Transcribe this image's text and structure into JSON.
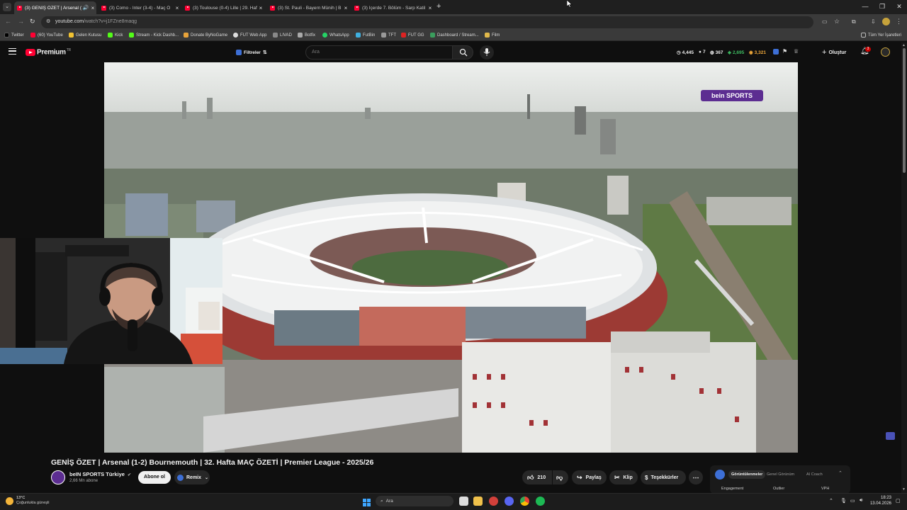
{
  "browser": {
    "tabs": [
      {
        "label": "(3) GENİŞ ÖZET | Arsenal (1",
        "active": true
      },
      {
        "label": "(3) Como - Inter (3-4) - Maç Ö",
        "active": false
      },
      {
        "label": "(3) Toulouse (0-4) Lille | 29. Haf",
        "active": false
      },
      {
        "label": "(3) St. Pauli - Bayern Münih | B",
        "active": false
      },
      {
        "label": "(3) İçerde 7. Bölüm - Sarp Katil",
        "active": false
      }
    ],
    "url_host": "youtube.com",
    "url_path": "/watch?v=j1FZne8maqg",
    "bookmarks": [
      "Twitter",
      "(60) YouTube",
      "Gelen Kutusu",
      "Kick",
      "Stream - Kick Dashb...",
      "Donate ByNoGame",
      "FUT Web App",
      "LIVAD",
      "Botfix",
      "WhatsApp",
      "FutBin",
      "TFT",
      "FUT GG",
      "Dashboard / Stream...",
      "Film"
    ],
    "bookmarks_all": "Tüm Yer İşaretleri"
  },
  "yt": {
    "logo_text": "Premium",
    "logo_sup": "TR",
    "filter_label": "Filtreler",
    "search_placeholder": "Ara",
    "stats": [
      "4,445",
      "7",
      "367",
      "2,695",
      "3,321"
    ],
    "create_label": "Oluştur",
    "notif_count": "3"
  },
  "video": {
    "channel_logo": "bein SPORTS",
    "title": "GENİŞ ÖZET | Arsenal (1-2) Bournemouth | 32. Hafta MAÇ ÖZETİ | Premier League - 2025/26",
    "channel_name": "beIN SPORTS Türkiye",
    "subscribers": "2,66 Mn abone",
    "subscribe_label": "Abone ol",
    "remix_label": "Remix",
    "likes": "210",
    "share_label": "Paylaş",
    "clip_label": "Klip",
    "thanks_label": "Teşekkürler"
  },
  "panel": {
    "tabs": [
      "Görüntülenmeler",
      "Genel Görünüm",
      "AI Coach"
    ],
    "columns": [
      "Engagement",
      "Outlier",
      "VPH"
    ]
  },
  "taskbar": {
    "weather_temp": "13°C",
    "weather_desc": "Çoğunlukla güneşli",
    "search_placeholder": "Ara",
    "time": "18:23",
    "date": "13.04.2026"
  },
  "colors": {
    "accent_red": "#ff0033",
    "bg": "#0f0f0f",
    "bein_purple": "#5c2d91"
  }
}
